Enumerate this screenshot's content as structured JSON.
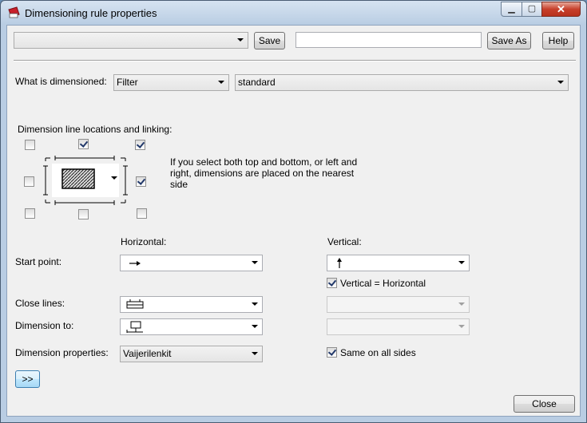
{
  "window": {
    "title": "Dimensioning rule properties",
    "icon": "dimension-tool-icon",
    "minimize_icon": "minimize-icon",
    "maximize_icon": "maximize-icon",
    "close_icon": "close-icon",
    "close_glyph": "✕",
    "minimize_glyph": "▁",
    "maximize_glyph": "▢"
  },
  "toolbar": {
    "preset_value": "",
    "save_label": "Save",
    "save_as_value": "",
    "save_as_label": "Save As",
    "help_label": "Help"
  },
  "what": {
    "label": "What is dimensioned:",
    "type_value": "Filter",
    "filter_value": "standard"
  },
  "locations": {
    "label": "Dimension line locations and linking:",
    "note": "If you select both top and bottom, or left and right, dimensions are placed on the nearest side",
    "checkboxes": {
      "top_left": false,
      "top_center": true,
      "top_right": true,
      "left": false,
      "right": true,
      "bottom_left": false,
      "bottom_center": false,
      "bottom_right": false
    }
  },
  "columns": {
    "horizontal": "Horizontal:",
    "vertical": "Vertical:"
  },
  "start_point": {
    "label": "Start point:",
    "horizontal_icon": "arrow-right-icon",
    "vertical_icon": "arrow-up-icon"
  },
  "vertical_equals_horizontal": {
    "label": "Vertical = Horizontal",
    "checked": true
  },
  "close_lines": {
    "label": "Close lines:",
    "horizontal_icon": "close-lines-icon"
  },
  "dimension_to": {
    "label": "Dimension to:",
    "horizontal_icon": "dimension-to-icon"
  },
  "dimension_properties": {
    "label": "Dimension properties:",
    "value": "Vaijerilenkit"
  },
  "same_on_all_sides": {
    "label": "Same on all sides",
    "checked": true
  },
  "expand_label": ">>",
  "close_label": "Close"
}
